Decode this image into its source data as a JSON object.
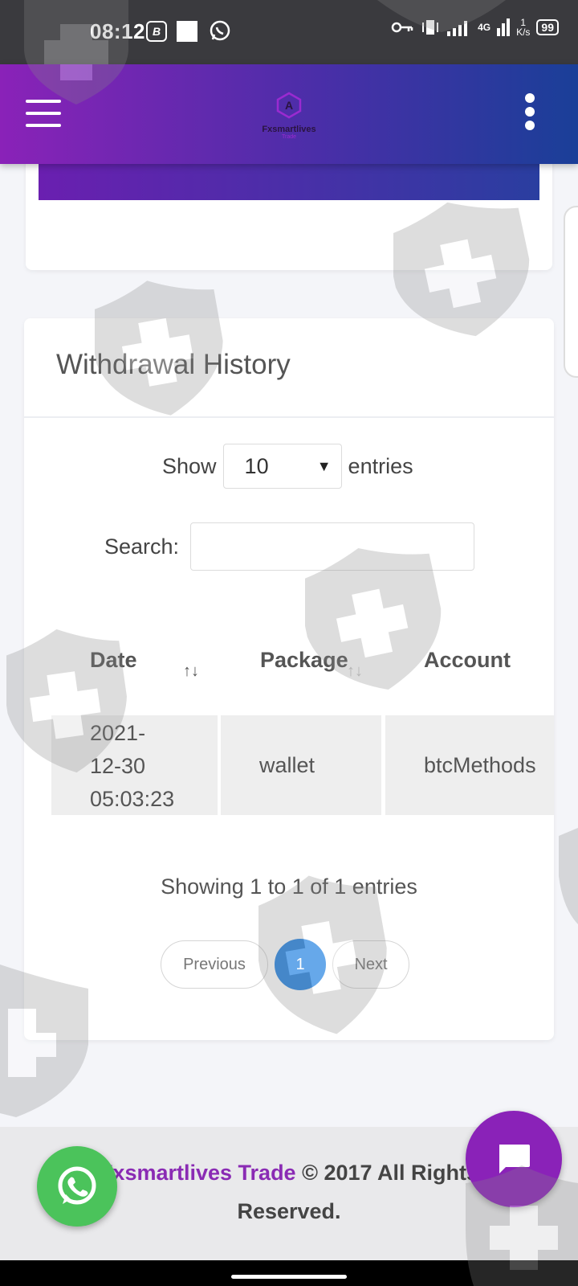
{
  "status_bar": {
    "time": "08:12",
    "b_badge": "B",
    "network": "4G",
    "speed_value": "1",
    "speed_unit": "K/s",
    "battery": "99"
  },
  "app_bar": {
    "logo_name": "Fxsmartlives",
    "logo_sub": "Trade",
    "icons": [
      "hamburger-menu-icon",
      "more-vert-icon"
    ]
  },
  "withdrawal": {
    "title": "Withdrawal History",
    "show_label": "Show",
    "page_length": "10",
    "entries_label": "entries",
    "search_label": "Search:",
    "search_value": "",
    "columns": [
      "Date",
      "Package",
      "Account"
    ],
    "rows": [
      {
        "date_line1": "2021-",
        "date_line2": "12-30",
        "date_line3": "05:03:23",
        "package": "wallet",
        "account": "btcMethods"
      }
    ],
    "info": "Showing 1 to 1 of 1 entries",
    "pagination": {
      "previous": "Previous",
      "current": "1",
      "next": "Next"
    }
  },
  "footer": {
    "brand": "Fxsmartlives Trade",
    "copyright": " © 2017 All Rights",
    "reserved": "Reserved."
  },
  "colors": {
    "header_start": "#8a22b8",
    "header_end": "#1a3f98",
    "page_active": "#2b87e3",
    "brand_purple": "#8a2bb4",
    "whatsapp_green": "#4bc35b"
  }
}
